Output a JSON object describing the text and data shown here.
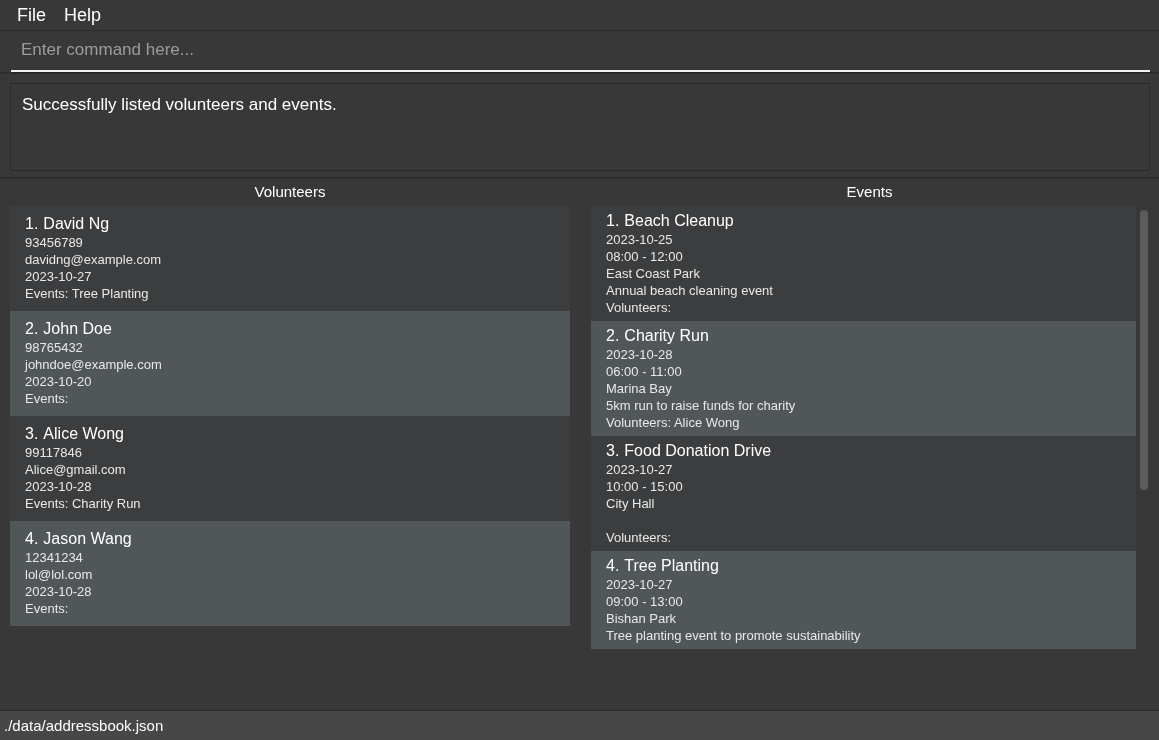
{
  "menu": [
    {
      "label": "File"
    },
    {
      "label": "Help"
    }
  ],
  "command_box": {
    "placeholder": "Enter command here..."
  },
  "result_display": {
    "text": "Successfully listed volunteers and events."
  },
  "volunteers": {
    "title": "Volunteers",
    "items": [
      {
        "index": "1.",
        "name": "David Ng",
        "phone": "93456789",
        "email": "davidng@example.com",
        "date": "2023-10-27",
        "events": "Events: Tree Planting"
      },
      {
        "index": "2.",
        "name": "John Doe",
        "phone": "98765432",
        "email": "johndoe@example.com",
        "date": "2023-10-20",
        "events": "Events:"
      },
      {
        "index": "3.",
        "name": "Alice Wong",
        "phone": "99117846",
        "email": "Alice@gmail.com",
        "date": "2023-10-28",
        "events": "Events: Charity Run"
      },
      {
        "index": "4.",
        "name": "Jason Wang",
        "phone": "12341234",
        "email": "lol@lol.com",
        "date": "2023-10-28",
        "events": "Events:"
      }
    ]
  },
  "events": {
    "title": "Events",
    "items": [
      {
        "index": "1.",
        "name": "Beach Cleanup",
        "date": "2023-10-25",
        "time": "08:00 - 12:00",
        "location": "East Coast Park",
        "description": "Annual beach cleaning event",
        "volunteers": "Volunteers:"
      },
      {
        "index": "2.",
        "name": "Charity Run",
        "date": "2023-10-28",
        "time": "06:00 - 11:00",
        "location": "Marina Bay",
        "description": "5km run to raise funds for charity",
        "volunteers": "Volunteers: Alice Wong"
      },
      {
        "index": "3.",
        "name": "Food Donation Drive",
        "date": "2023-10-27",
        "time": "10:00 - 15:00",
        "location": "City Hall",
        "volunteers": "Volunteers:"
      },
      {
        "index": "4.",
        "name": "Tree Planting",
        "date": "2023-10-27",
        "time": "09:00 - 13:00",
        "location": "Bishan Park",
        "description": "Tree planting event to promote sustainability"
      }
    ]
  },
  "status_bar": {
    "text": "./data/addressbook.json"
  }
}
